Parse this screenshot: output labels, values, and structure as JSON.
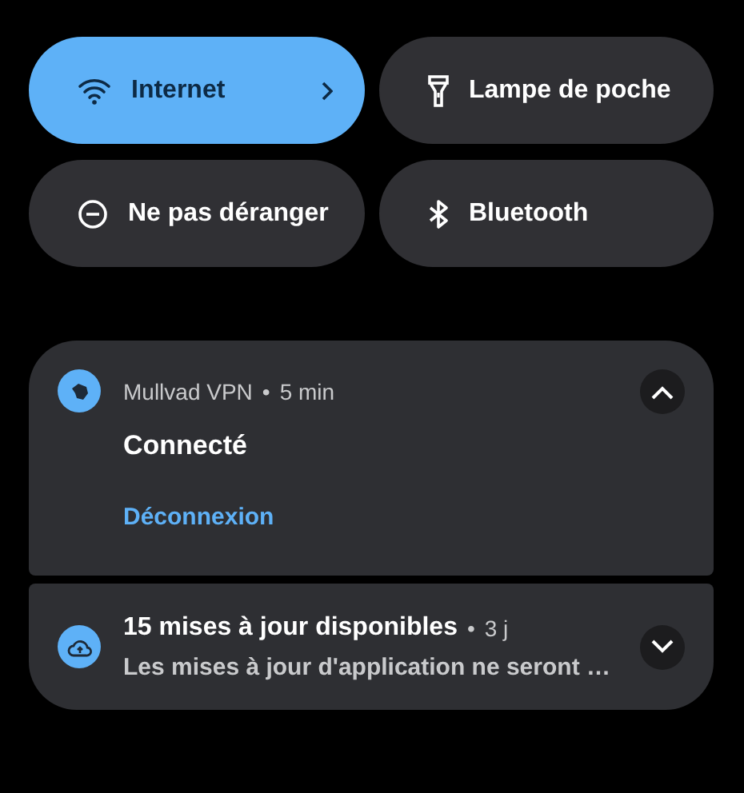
{
  "quick_tiles": [
    {
      "label": "Internet",
      "on": true,
      "has_chevron": true
    },
    {
      "label": "Lampe de poche",
      "on": false,
      "has_chevron": false
    },
    {
      "label": "Ne pas déranger",
      "on": false,
      "has_chevron": false
    },
    {
      "label": "Bluetooth",
      "on": false,
      "has_chevron": false
    }
  ],
  "notifications": [
    {
      "app": "Mullvad VPN",
      "separator": "•",
      "time": "5 min",
      "title": "Connecté",
      "action": "Déconnexion",
      "expanded": true
    },
    {
      "title": "15 mises à jour disponibles",
      "separator": "•",
      "time": "3 j",
      "text": "Les mises à jour d'application ne seront …",
      "expanded": false
    }
  ]
}
